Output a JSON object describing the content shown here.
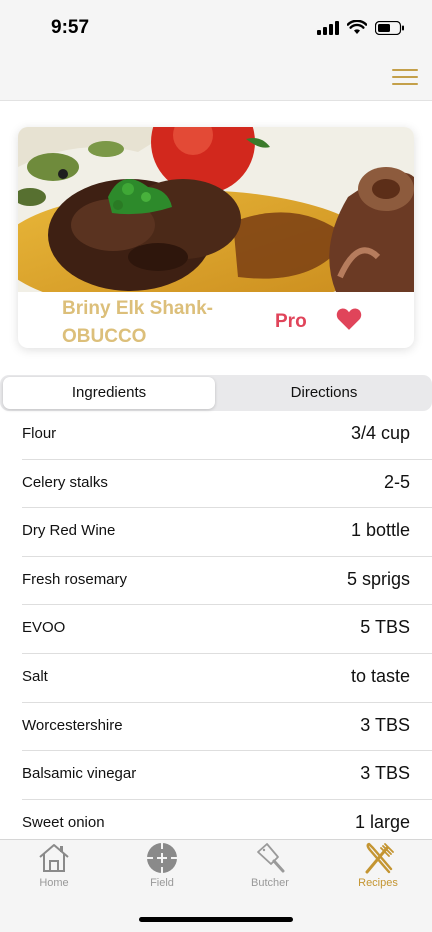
{
  "status_bar": {
    "time": "9:57",
    "icons": [
      "cellular-signal-icon",
      "wifi-icon",
      "battery-icon"
    ]
  },
  "nav": {
    "menu_icon": "hamburger-menu-icon",
    "accent_color": "#c4a04a"
  },
  "recipe": {
    "title_line1": "Briny Elk Shank-",
    "title_line2": "OBUCCO",
    "badge": "Pro",
    "favorite_icon": "heart-icon",
    "title_color": "#dcbf7a",
    "badge_color": "#e0445a"
  },
  "tabs": {
    "ingredients": "Ingredients",
    "directions": "Directions",
    "selected": "Ingredients"
  },
  "ingredients": [
    {
      "name": "Flour",
      "amount": "3/4 cup"
    },
    {
      "name": "Celery stalks",
      "amount": "2-5"
    },
    {
      "name": "Dry Red Wine",
      "amount": "1 bottle"
    },
    {
      "name": "Fresh rosemary",
      "amount": "5 sprigs"
    },
    {
      "name": "EVOO",
      "amount": "5 TBS"
    },
    {
      "name": "Salt",
      "amount": "to taste"
    },
    {
      "name": "Worcestershire",
      "amount": "3 TBS"
    },
    {
      "name": "Balsamic vinegar",
      "amount": "3 TBS"
    },
    {
      "name": "Sweet onion",
      "amount": "1 large"
    }
  ],
  "tab_bar": {
    "items": [
      {
        "label": "Home",
        "icon": "home-icon"
      },
      {
        "label": "Field",
        "icon": "crosshair-icon"
      },
      {
        "label": "Butcher",
        "icon": "cleaver-icon"
      },
      {
        "label": "Recipes",
        "icon": "fork-knife-icon"
      }
    ],
    "active": "Recipes",
    "active_color": "#c49532"
  }
}
